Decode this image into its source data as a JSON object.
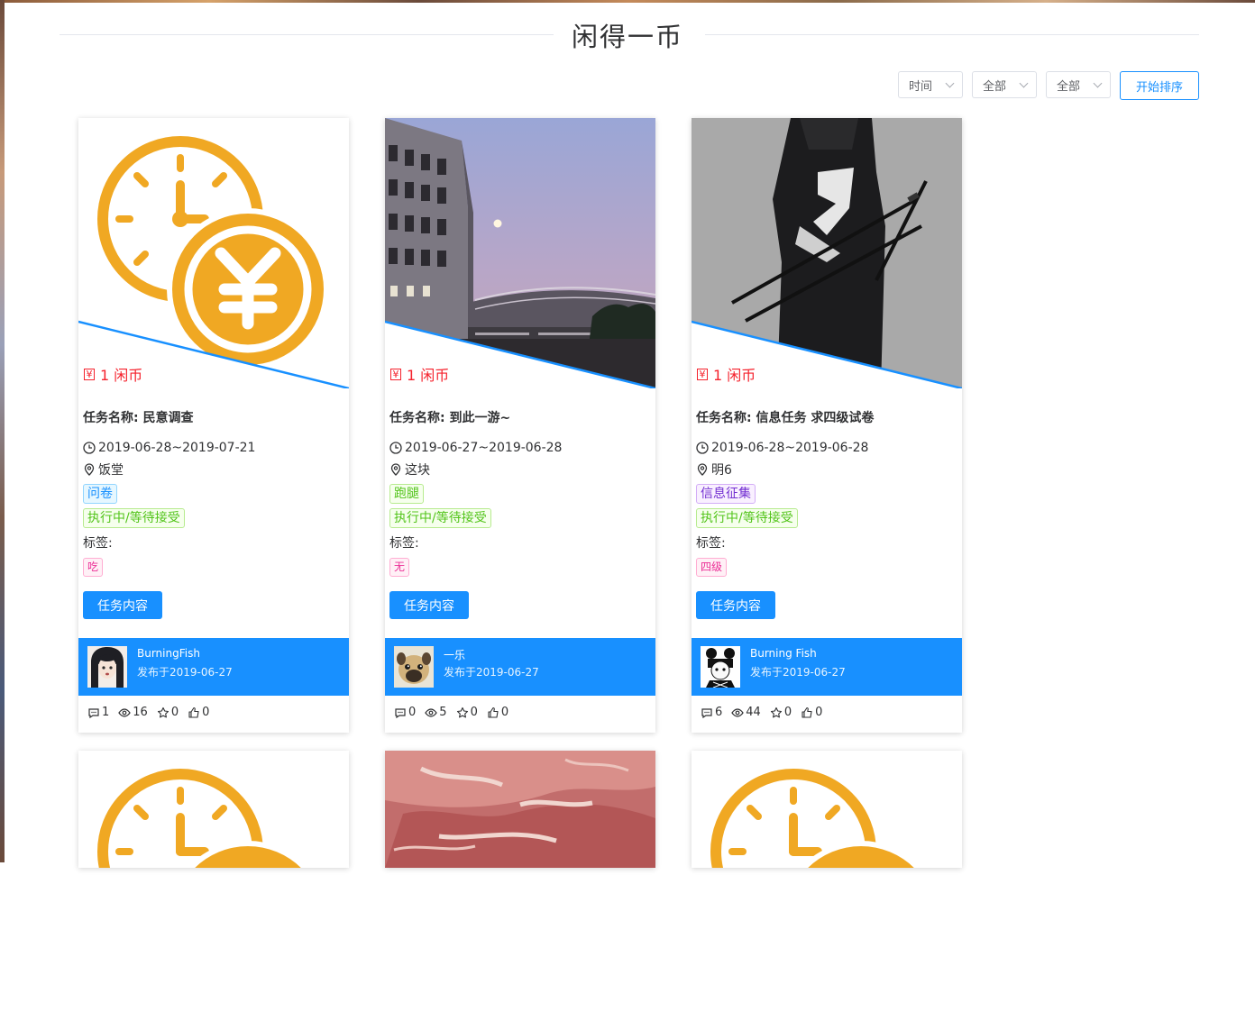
{
  "page": {
    "title": "闲得一币"
  },
  "toolbar": {
    "sort_field": "时间",
    "filter_type": "全部",
    "filter_status": "全部",
    "sort_button": "开始排序"
  },
  "labels": {
    "tags_title": "标签:",
    "detail_button": "任务内容"
  },
  "cards": [
    {
      "reward": "1 闲币",
      "name": "任务名称: 民意调查",
      "date": "2019-06-28~2019-07-21",
      "place": "饭堂",
      "type": "问卷",
      "status": "执行中/等待接受",
      "tag": "吃",
      "author": "BurningFish",
      "published": "发布于2019-06-27",
      "comments": "1",
      "views": "16",
      "stars": "0",
      "likes": "0"
    },
    {
      "reward": "1 闲币",
      "name": "任务名称: 到此一游~",
      "date": "2019-06-27~2019-06-28",
      "place": "这块",
      "type": "跑腿",
      "status": "执行中/等待接受",
      "tag": "无",
      "author": "一乐",
      "published": "发布于2019-06-27",
      "comments": "0",
      "views": "5",
      "stars": "0",
      "likes": "0"
    },
    {
      "reward": "1 闲币",
      "name": "任务名称: 信息任务 求四级试卷",
      "date": "2019-06-28~2019-06-28",
      "place": "明6",
      "type": "信息征集",
      "status": "执行中/等待接受",
      "tag": "四级",
      "author": "Burning Fish",
      "published": "发布于2019-06-27",
      "comments": "6",
      "views": "44",
      "stars": "0",
      "likes": "0"
    }
  ],
  "icons": {
    "reward": "coin-icon",
    "date": "clock-icon",
    "place": "location-pin-icon",
    "comments": "comment-icon",
    "views": "eye-icon",
    "stars": "star-icon",
    "likes": "thumbs-up-icon"
  },
  "colors": {
    "accent": "#1890ff",
    "coin": "#f0a823",
    "reward": "#f5222d"
  }
}
